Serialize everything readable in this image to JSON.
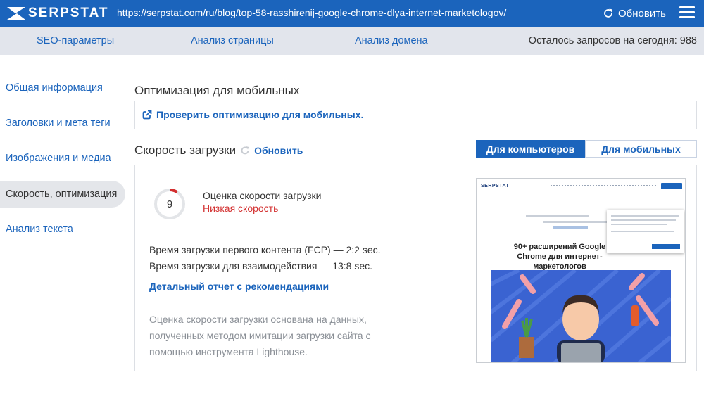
{
  "topbar": {
    "brand": "SERPSTAT",
    "url": "https://serpstat.com/ru/blog/top-58-rasshirenij-google-chrome-dlya-internet-marketologov/",
    "refresh_label": "Обновить",
    "refresh_icon": "refresh-icon",
    "menu_icon": "hamburger-menu-icon",
    "bg_color": "#1b64bc"
  },
  "tabs": {
    "items": [
      {
        "label": "SEO-параметры"
      },
      {
        "label": "Анализ страницы"
      },
      {
        "label": "Анализ домена"
      }
    ],
    "quota": "Осталось запросов на сегодня: 988"
  },
  "sidebar": {
    "items": [
      {
        "label": "Общая информация",
        "active": false
      },
      {
        "label": "Заголовки и мета теги",
        "active": false
      },
      {
        "label": "Изображения и медиа",
        "active": false
      },
      {
        "label": "Скорость, оптимизация",
        "active": true
      },
      {
        "label": "Анализ текста",
        "active": false
      }
    ]
  },
  "mobile": {
    "title": "Оптимизация для мобильных",
    "check_link": "Проверить оптимизацию для мобильных.",
    "link_icon": "external-link-icon"
  },
  "speed": {
    "title": "Скорость загрузки",
    "refresh_label": "Обновить",
    "refresh_icon": "refresh-icon",
    "toggle_desktop": "Для компьютеров",
    "toggle_mobile": "Для мобильных",
    "active_toggle": "desktop",
    "score": "9",
    "score_fraction": 0.09,
    "score_label": "Оценка скорости загрузки",
    "score_status": "Низкая скорость",
    "status_color": "#d32f2f",
    "fcp": "Время загрузки первого контента (FCP) — 2:2 sec.",
    "tti": "Время загрузки для взаимодействия — 13:8 sec.",
    "report_link": "Детальный отчет с рекомендациями",
    "note": "Оценка скорости загрузки основана на данных, полученных методом имитации загрузки сайта с помощью инструмента Lighthouse.",
    "preview": {
      "logo": "SERPSTAT",
      "headline": "90+ расширений Google Chrome для интернет-маркетологов"
    }
  }
}
